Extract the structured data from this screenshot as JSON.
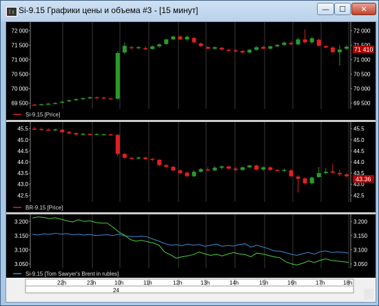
{
  "window": {
    "title": "Si-9.15 Графики цены и объема #3 - [15 минут]",
    "minimize_glyph": "—",
    "maximize_glyph": "☐",
    "close_glyph": "✕",
    "icon": "candlestick-chart-icon"
  },
  "colors": {
    "background": "#000000",
    "grid": "#3a3a3a",
    "up_candle": "#2a9a2a",
    "down_candle": "#e02020",
    "axis_text": "#ffffff",
    "price_tag": "#b00000",
    "line_blue": "#3a8fd6",
    "line_green": "#4ad43a"
  },
  "panel1": {
    "legend": "Si-9.15 [Price]",
    "last_price": "71 410",
    "axis_labels": [
      "72 000",
      "71 500",
      "71 000",
      "70 500",
      "70 000",
      "69 500"
    ]
  },
  "panel2": {
    "legend": "BR-9.15 [Price]",
    "last_price": "43.36",
    "axis_labels": [
      "45.5",
      "45.0",
      "44.5",
      "44.0",
      "43.5",
      "43.0",
      "42.5"
    ]
  },
  "panel3": {
    "legend": "Si-9.15 [Tom Sawyer's Brent in rubles]",
    "axis_labels": [
      "3.200",
      "3.150",
      "3.100",
      "3.050"
    ]
  },
  "time_axis": {
    "hours": [
      "22h",
      "23h",
      "10h",
      "11h",
      "12h",
      "13h",
      "14h",
      "15h",
      "16h",
      "17h",
      "18h"
    ],
    "day_label": "24"
  },
  "chart_data": [
    {
      "type": "candlestick",
      "name": "Si-9.15 [Price]",
      "ylim": [
        69300,
        72300
      ],
      "candles": [
        {
          "o": 69450,
          "h": 69470,
          "l": 69420,
          "c": 69440
        },
        {
          "o": 69450,
          "h": 69480,
          "l": 69430,
          "c": 69460
        },
        {
          "o": 69460,
          "h": 69510,
          "l": 69450,
          "c": 69480
        },
        {
          "o": 69490,
          "h": 69530,
          "l": 69470,
          "c": 69500
        },
        {
          "o": 69510,
          "h": 69570,
          "l": 69500,
          "c": 69550
        },
        {
          "o": 69560,
          "h": 69620,
          "l": 69540,
          "c": 69600
        },
        {
          "o": 69600,
          "h": 69660,
          "l": 69580,
          "c": 69640
        },
        {
          "o": 69650,
          "h": 69690,
          "l": 69600,
          "c": 69670
        },
        {
          "o": 69680,
          "h": 69730,
          "l": 69640,
          "c": 69700
        },
        {
          "o": 69700,
          "h": 69730,
          "l": 69660,
          "c": 69680
        },
        {
          "o": 69690,
          "h": 69720,
          "l": 69650,
          "c": 69670
        },
        {
          "o": 69660,
          "h": 69690,
          "l": 69630,
          "c": 69640
        },
        {
          "o": 69650,
          "h": 71300,
          "l": 69620,
          "c": 71230
        },
        {
          "o": 71250,
          "h": 71600,
          "l": 71200,
          "c": 71480
        },
        {
          "o": 71430,
          "h": 71480,
          "l": 71350,
          "c": 71400
        },
        {
          "o": 71400,
          "h": 71470,
          "l": 71360,
          "c": 71430
        },
        {
          "o": 71400,
          "h": 71460,
          "l": 71330,
          "c": 71360
        },
        {
          "o": 71370,
          "h": 71490,
          "l": 71350,
          "c": 71460
        },
        {
          "o": 71460,
          "h": 71560,
          "l": 71420,
          "c": 71530
        },
        {
          "o": 71540,
          "h": 71720,
          "l": 71520,
          "c": 71700
        },
        {
          "o": 71700,
          "h": 71830,
          "l": 71670,
          "c": 71800
        },
        {
          "o": 71800,
          "h": 71840,
          "l": 71680,
          "c": 71700
        },
        {
          "o": 71700,
          "h": 71830,
          "l": 71640,
          "c": 71790
        },
        {
          "o": 71750,
          "h": 71790,
          "l": 71560,
          "c": 71600
        },
        {
          "o": 71560,
          "h": 71590,
          "l": 71440,
          "c": 71470
        },
        {
          "o": 71440,
          "h": 71460,
          "l": 71360,
          "c": 71380
        },
        {
          "o": 71380,
          "h": 71460,
          "l": 71340,
          "c": 71430
        },
        {
          "o": 71410,
          "h": 71440,
          "l": 71320,
          "c": 71350
        },
        {
          "o": 71340,
          "h": 71380,
          "l": 71280,
          "c": 71320
        },
        {
          "o": 71320,
          "h": 71360,
          "l": 71260,
          "c": 71300
        },
        {
          "o": 71300,
          "h": 71340,
          "l": 71220,
          "c": 71250
        },
        {
          "o": 71250,
          "h": 71370,
          "l": 71220,
          "c": 71340
        },
        {
          "o": 71340,
          "h": 71470,
          "l": 71310,
          "c": 71430
        },
        {
          "o": 71440,
          "h": 71480,
          "l": 71360,
          "c": 71380
        },
        {
          "o": 71380,
          "h": 71480,
          "l": 71360,
          "c": 71460
        },
        {
          "o": 71460,
          "h": 71540,
          "l": 71430,
          "c": 71510
        },
        {
          "o": 71510,
          "h": 71620,
          "l": 71470,
          "c": 71590
        },
        {
          "o": 71580,
          "h": 71650,
          "l": 71500,
          "c": 71530
        },
        {
          "o": 71530,
          "h": 71760,
          "l": 71500,
          "c": 71700
        },
        {
          "o": 71700,
          "h": 72050,
          "l": 71560,
          "c": 71600
        },
        {
          "o": 71600,
          "h": 71790,
          "l": 71560,
          "c": 71740
        },
        {
          "o": 71690,
          "h": 71720,
          "l": 71460,
          "c": 71480
        },
        {
          "o": 71470,
          "h": 71500,
          "l": 71390,
          "c": 71420
        },
        {
          "o": 71420,
          "h": 71460,
          "l": 71230,
          "c": 71260
        },
        {
          "o": 71260,
          "h": 71490,
          "l": 70800,
          "c": 71350
        },
        {
          "o": 71380,
          "h": 71490,
          "l": 71330,
          "c": 71450
        }
      ]
    },
    {
      "type": "candlestick",
      "name": "BR-9.15 [Price]",
      "ylim": [
        42.2,
        45.8
      ],
      "candles": [
        {
          "o": 45.5,
          "h": 45.58,
          "l": 45.44,
          "c": 45.47
        },
        {
          "o": 45.48,
          "h": 45.55,
          "l": 45.42,
          "c": 45.45
        },
        {
          "o": 45.46,
          "h": 45.53,
          "l": 45.4,
          "c": 45.42
        },
        {
          "o": 45.42,
          "h": 45.5,
          "l": 45.38,
          "c": 45.47
        },
        {
          "o": 45.45,
          "h": 45.48,
          "l": 45.32,
          "c": 45.34
        },
        {
          "o": 45.35,
          "h": 45.4,
          "l": 45.26,
          "c": 45.28
        },
        {
          "o": 45.3,
          "h": 45.33,
          "l": 45.2,
          "c": 45.24
        },
        {
          "o": 45.25,
          "h": 45.3,
          "l": 45.2,
          "c": 45.27
        },
        {
          "o": 45.26,
          "h": 45.3,
          "l": 45.2,
          "c": 45.23
        },
        {
          "o": 45.25,
          "h": 45.28,
          "l": 45.2,
          "c": 45.26
        },
        {
          "o": 45.25,
          "h": 45.28,
          "l": 45.2,
          "c": 45.25
        },
        {
          "o": 45.24,
          "h": 45.28,
          "l": 45.18,
          "c": 45.22
        },
        {
          "o": 45.22,
          "h": 45.25,
          "l": 44.26,
          "c": 44.36
        },
        {
          "o": 44.36,
          "h": 44.4,
          "l": 44.14,
          "c": 44.19
        },
        {
          "o": 44.18,
          "h": 44.24,
          "l": 44.12,
          "c": 44.16
        },
        {
          "o": 44.17,
          "h": 44.25,
          "l": 44.12,
          "c": 44.2
        },
        {
          "o": 44.2,
          "h": 44.24,
          "l": 44.1,
          "c": 44.13
        },
        {
          "o": 44.14,
          "h": 44.18,
          "l": 44.04,
          "c": 44.1
        },
        {
          "o": 44.1,
          "h": 44.12,
          "l": 43.8,
          "c": 43.86
        },
        {
          "o": 43.86,
          "h": 43.9,
          "l": 43.74,
          "c": 43.78
        },
        {
          "o": 43.78,
          "h": 43.82,
          "l": 43.56,
          "c": 43.62
        },
        {
          "o": 43.62,
          "h": 43.66,
          "l": 43.44,
          "c": 43.5
        },
        {
          "o": 43.52,
          "h": 43.56,
          "l": 43.32,
          "c": 43.36
        },
        {
          "o": 43.36,
          "h": 43.62,
          "l": 43.32,
          "c": 43.56
        },
        {
          "o": 43.56,
          "h": 43.72,
          "l": 43.52,
          "c": 43.68
        },
        {
          "o": 43.66,
          "h": 43.76,
          "l": 43.58,
          "c": 43.62
        },
        {
          "o": 43.62,
          "h": 43.8,
          "l": 43.58,
          "c": 43.74
        },
        {
          "o": 43.74,
          "h": 43.84,
          "l": 43.66,
          "c": 43.8
        },
        {
          "o": 43.8,
          "h": 43.84,
          "l": 43.66,
          "c": 43.7
        },
        {
          "o": 43.7,
          "h": 43.76,
          "l": 43.6,
          "c": 43.64
        },
        {
          "o": 43.64,
          "h": 43.8,
          "l": 43.6,
          "c": 43.76
        },
        {
          "o": 43.76,
          "h": 43.88,
          "l": 43.72,
          "c": 43.84
        },
        {
          "o": 43.84,
          "h": 43.88,
          "l": 43.6,
          "c": 43.66
        },
        {
          "o": 43.66,
          "h": 43.8,
          "l": 43.6,
          "c": 43.76
        },
        {
          "o": 43.76,
          "h": 43.8,
          "l": 43.6,
          "c": 43.64
        },
        {
          "o": 43.64,
          "h": 43.68,
          "l": 43.6,
          "c": 43.62
        },
        {
          "o": 43.62,
          "h": 43.7,
          "l": 43.55,
          "c": 43.64
        },
        {
          "o": 43.62,
          "h": 43.66,
          "l": 43.3,
          "c": 43.36
        },
        {
          "o": 43.34,
          "h": 43.4,
          "l": 42.62,
          "c": 43.24
        },
        {
          "o": 43.26,
          "h": 43.3,
          "l": 42.98,
          "c": 43.04
        },
        {
          "o": 43.04,
          "h": 43.34,
          "l": 42.98,
          "c": 43.3
        },
        {
          "o": 43.32,
          "h": 43.78,
          "l": 43.28,
          "c": 43.5
        },
        {
          "o": 43.5,
          "h": 43.72,
          "l": 43.44,
          "c": 43.56
        },
        {
          "o": 43.58,
          "h": 43.92,
          "l": 43.46,
          "c": 43.52
        },
        {
          "o": 43.5,
          "h": 43.66,
          "l": 43.38,
          "c": 43.44
        },
        {
          "o": 43.44,
          "h": 43.5,
          "l": 43.3,
          "c": 43.36
        }
      ]
    },
    {
      "type": "line",
      "name": "Si-9.15 [Tom Sawyer's Brent in rubles]",
      "ylim": [
        3.035,
        3.225
      ],
      "series": [
        {
          "color": "line_blue",
          "values": [
            3.155,
            3.152,
            3.156,
            3.154,
            3.158,
            3.155,
            3.157,
            3.153,
            3.155,
            3.152,
            3.154,
            3.15,
            3.152,
            3.153,
            3.15,
            3.155,
            3.149,
            3.147,
            3.146,
            3.148,
            3.145,
            3.137,
            3.13,
            3.122,
            3.116,
            3.118,
            3.114,
            3.12,
            3.116,
            3.118,
            3.112,
            3.116,
            3.12,
            3.112,
            3.115,
            3.113,
            3.118,
            3.121,
            3.109,
            3.116,
            3.11,
            3.104,
            3.096,
            3.095,
            3.09,
            3.084,
            3.08,
            3.086,
            3.091,
            3.084,
            3.093,
            3.096,
            3.09,
            3.092,
            3.091,
            3.088
          ]
        },
        {
          "color": "line_green",
          "values": [
            3.212,
            3.216,
            3.214,
            3.21,
            3.213,
            3.208,
            3.202,
            3.198,
            3.206,
            3.2,
            3.202,
            3.196,
            3.194,
            3.194,
            3.18,
            3.163,
            3.152,
            3.136,
            3.13,
            3.133,
            3.128,
            3.124,
            3.116,
            3.092,
            3.082,
            3.07,
            3.075,
            3.078,
            3.083,
            3.092,
            3.085,
            3.08,
            3.084,
            3.078,
            3.085,
            3.09,
            3.085,
            3.083,
            3.075,
            3.088,
            3.085,
            3.08,
            3.075,
            3.072,
            3.058,
            3.05,
            3.046,
            3.052,
            3.06,
            3.055,
            3.062,
            3.068,
            3.062,
            3.06,
            3.058,
            3.055
          ]
        }
      ]
    }
  ]
}
